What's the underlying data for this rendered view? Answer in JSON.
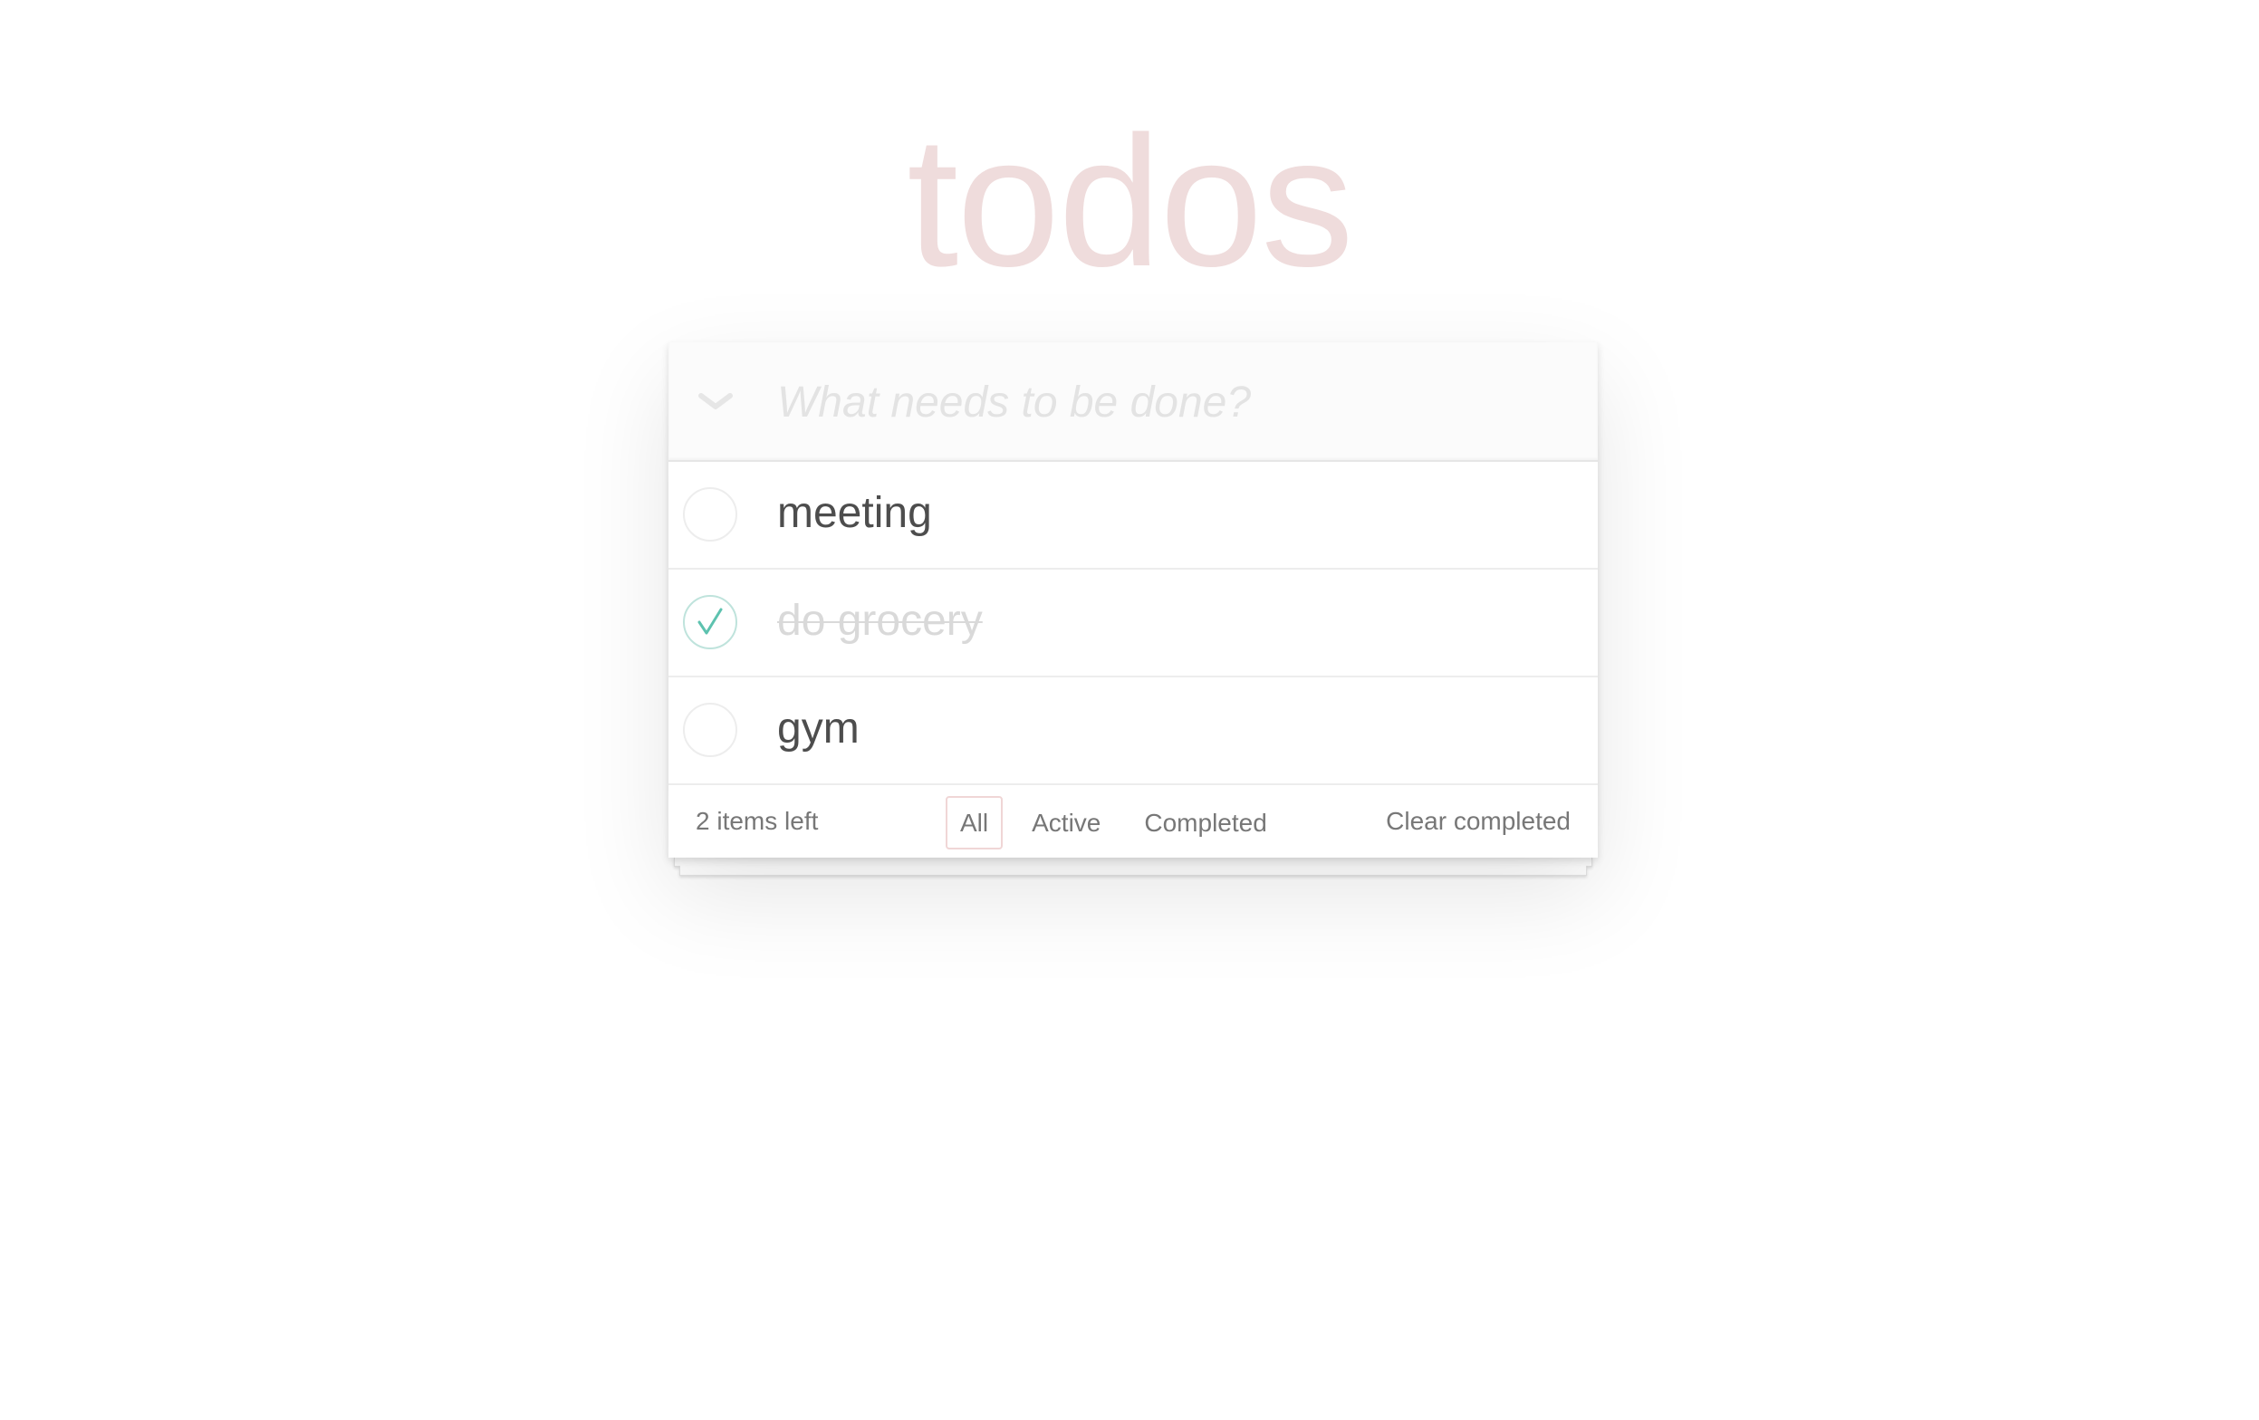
{
  "header": {
    "title": "todos",
    "new_todo_placeholder": "What needs to be done?"
  },
  "todos": [
    {
      "label": "meeting",
      "completed": false
    },
    {
      "label": "do grocery",
      "completed": true
    },
    {
      "label": "gym",
      "completed": false
    }
  ],
  "footer": {
    "count_text": "2 items left",
    "filters": [
      {
        "label": "All",
        "selected": true
      },
      {
        "label": "Active",
        "selected": false
      },
      {
        "label": "Completed",
        "selected": false
      }
    ],
    "clear_completed_label": "Clear completed"
  },
  "colors": {
    "title": "#efdcdc",
    "check_done": "#5dc2af",
    "selected_filter_border": "#f0d6d6"
  },
  "icons": {
    "toggle_all": "chevron-down-icon",
    "check_done": "checkmark-icon"
  }
}
